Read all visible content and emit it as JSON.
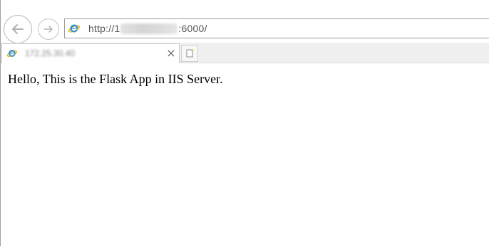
{
  "address_bar": {
    "url_prefix": "http://1",
    "url_suffix": ":6000/"
  },
  "tab": {
    "title": "172.25.30.40",
    "close_glyph": "×"
  },
  "page": {
    "body_text": "Hello, This is the Flask App in IIS Server."
  },
  "colors": {
    "ie_blue": "#2a8ed8",
    "ie_gold": "#f0b400",
    "border": "#9c9c9c"
  },
  "icons": {
    "back": "back-arrow-icon",
    "forward": "forward-arrow-icon",
    "site": "internet-explorer-icon",
    "close": "close-icon",
    "new_tab": "new-tab-icon"
  }
}
